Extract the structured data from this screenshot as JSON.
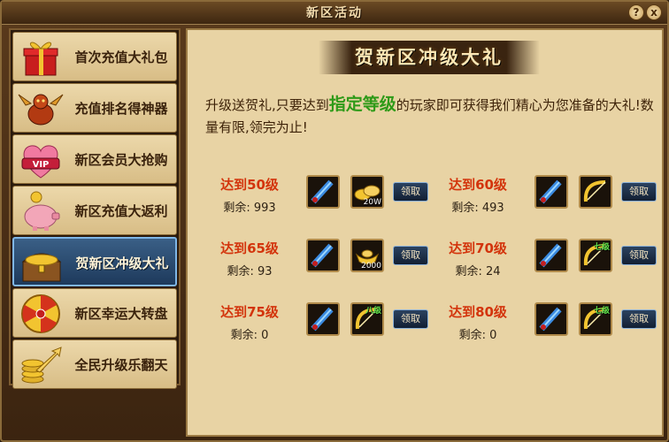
{
  "window": {
    "title": "新区活动",
    "help_label": "?",
    "close_label": "x"
  },
  "sidebar": {
    "items": [
      {
        "label": "首次充值大礼包",
        "icon": "gift-box-icon"
      },
      {
        "label": "充值排名得神器",
        "icon": "dragon-icon"
      },
      {
        "label": "新区会员大抢购",
        "icon": "vip-heart-icon"
      },
      {
        "label": "新区充值大返利",
        "icon": "piggy-bank-icon"
      },
      {
        "label": "贺新区冲级大礼",
        "icon": "treasure-chest-icon",
        "active": true
      },
      {
        "label": "新区幸运大转盘",
        "icon": "lucky-wheel-icon"
      },
      {
        "label": "全民升级乐翻天",
        "icon": "coin-stack-arrow-icon"
      }
    ]
  },
  "main": {
    "banner_title": "贺新区冲级大礼",
    "desc_before": "升级送贺礼,只要达到",
    "desc_highlight": "指定等级",
    "desc_after": "的玩家即可获得我们精心为您准备的大礼!数量有限,领完为止!",
    "claim_label": "领取",
    "rewards": [
      {
        "level": "达到50级",
        "remain": "剩余: 993",
        "item1": "scroll-icon",
        "item2": "gold-ingots-icon",
        "item2_qty": "20W"
      },
      {
        "level": "达到60级",
        "remain": "剩余: 493",
        "item1": "scroll-icon",
        "item2": "golden-bow-icon"
      },
      {
        "level": "达到65级",
        "remain": "剩余: 93",
        "item1": "scroll-icon",
        "item2": "gold-ingot-icon",
        "item2_qty": "2000"
      },
      {
        "level": "达到70级",
        "remain": "剩余: 24",
        "item1": "scroll-icon",
        "item2": "golden-bow-icon",
        "item2_tag": "七级"
      },
      {
        "level": "达到75级",
        "remain": "剩余: 0",
        "item1": "scroll-icon",
        "item2": "golden-bow-icon",
        "item2_tag": "八级"
      },
      {
        "level": "达到80级",
        "remain": "剩余: 0",
        "item1": "scroll-icon",
        "item2": "golden-bow-icon",
        "item2_tag": "七级"
      }
    ]
  },
  "colors": {
    "accent_level": "#d3340c",
    "highlight": "#2e9a18",
    "panel_bg": "#e8d3a4",
    "active_tab": "#2c4c72"
  }
}
